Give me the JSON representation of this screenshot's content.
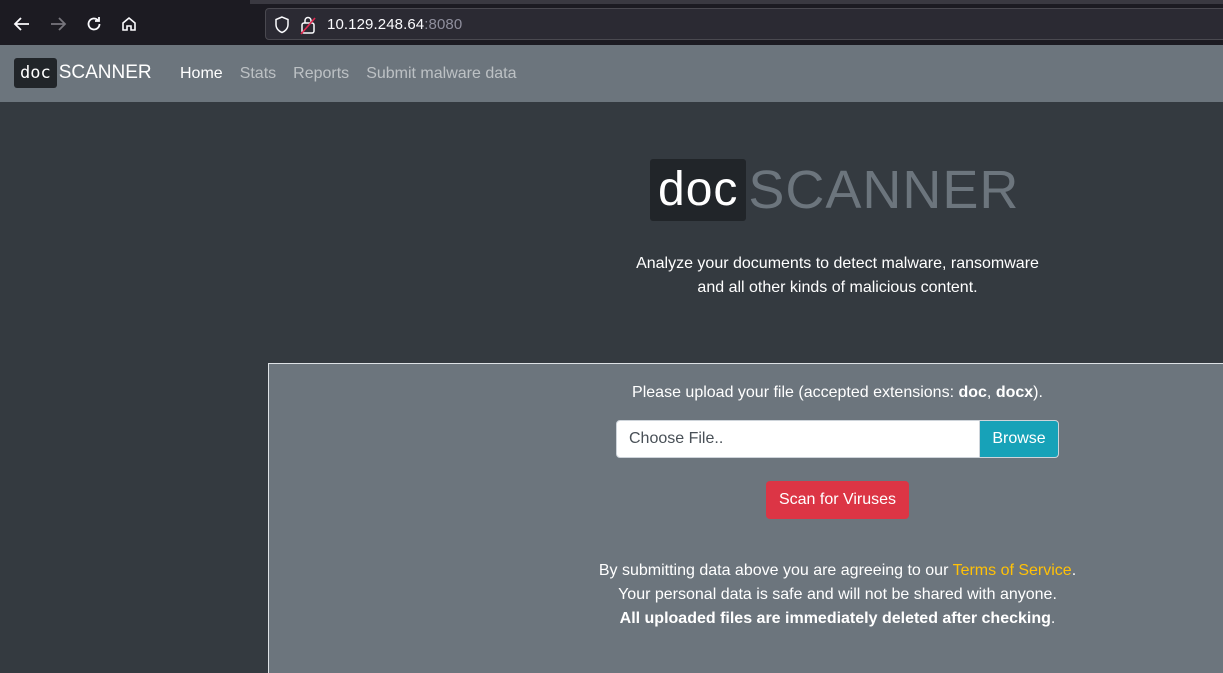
{
  "browser": {
    "url_host": "10.129.248.64",
    "url_port": ":8080"
  },
  "navbar": {
    "brand_doc": "doc",
    "brand_scanner": "SCANNER",
    "links": [
      "Home",
      "Stats",
      "Reports",
      "Submit malware data"
    ],
    "active": "Home"
  },
  "hero": {
    "title_doc": "doc",
    "title_scanner": "SCANNER",
    "subtitle_line1": "Analyze your documents to detect malware, ransomware",
    "subtitle_line2": "and all other kinds of malicious content."
  },
  "upload": {
    "label_prefix": "Please upload your file (accepted extensions: ",
    "ext1": "doc",
    "sep": ", ",
    "ext2": "docx",
    "label_suffix": ").",
    "file_placeholder": "Choose File..",
    "browse_label": "Browse",
    "scan_label": "Scan for Viruses"
  },
  "terms": {
    "line1_prefix": "By submitting data above you are agreeing to our ",
    "link": "Terms of Service",
    "line1_suffix": ".",
    "line2": "Your personal data is safe and will not be shared with anyone.",
    "line3_bold": "All uploaded files are immediately deleted after checking",
    "line3_suffix": "."
  },
  "colors": {
    "bg": "#343a40",
    "navbar": "#6c757d",
    "browse": "#17a2b8",
    "scan": "#dc3545",
    "link": "#ffc107"
  }
}
